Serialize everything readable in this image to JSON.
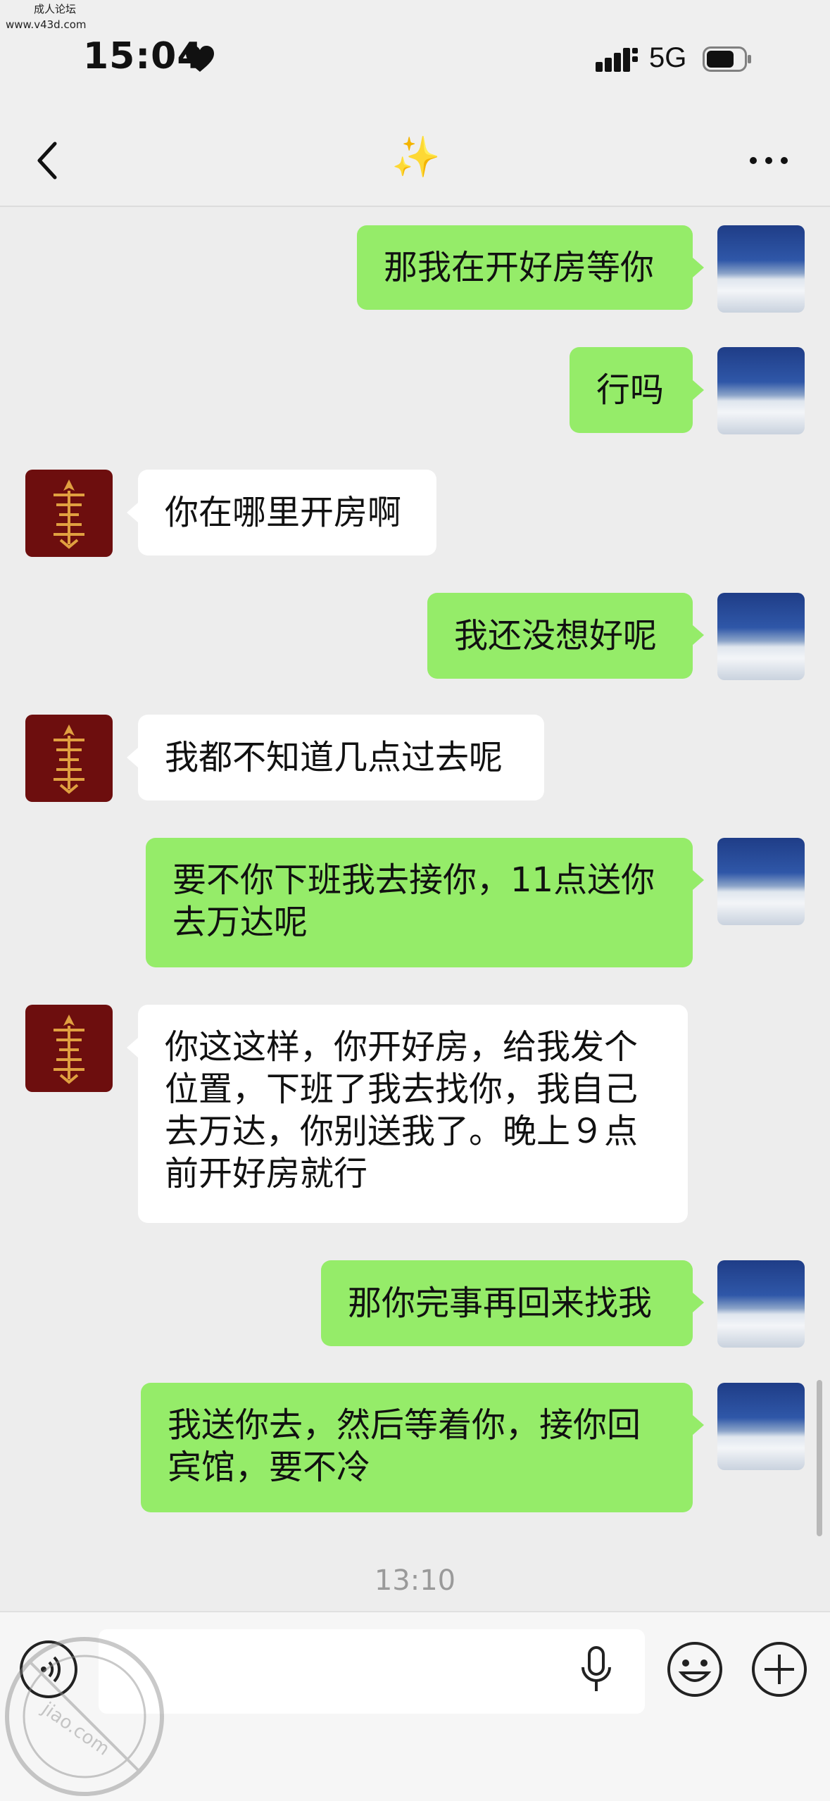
{
  "watermark": {
    "line1": "成人论坛",
    "line2": "www.v43d.com",
    "seal_text": "jiao.com"
  },
  "status_bar": {
    "time": "15:04",
    "network": "5G"
  },
  "header": {
    "title": "✨"
  },
  "messages": [
    {
      "side": "me",
      "text": "那我在开好房等你"
    },
    {
      "side": "me",
      "text": "行吗"
    },
    {
      "side": "other",
      "text": "你在哪里开房啊"
    },
    {
      "side": "me",
      "text": "我还没想好呢"
    },
    {
      "side": "other",
      "text": "我都不知道几点过去呢"
    },
    {
      "side": "me",
      "lines": [
        "要不你下班我去接你，11点送你",
        "去万达呢"
      ]
    },
    {
      "side": "other",
      "lines": [
        "你这这样，你开好房，给我发个",
        "位置，下班了我去找你，我自己",
        "去万达，你别送我了。晚上９点",
        "前开好房就行"
      ]
    },
    {
      "side": "me",
      "text": "那你完事再回来找我"
    },
    {
      "side": "me",
      "lines": [
        "我送你去，然后等着你，接你回",
        "宾馆，要不冷"
      ]
    }
  ],
  "timestamp": "13:10",
  "colors": {
    "me_bubble": "#95ec69",
    "other_bubble": "#ffffff",
    "background": "#ededed"
  }
}
